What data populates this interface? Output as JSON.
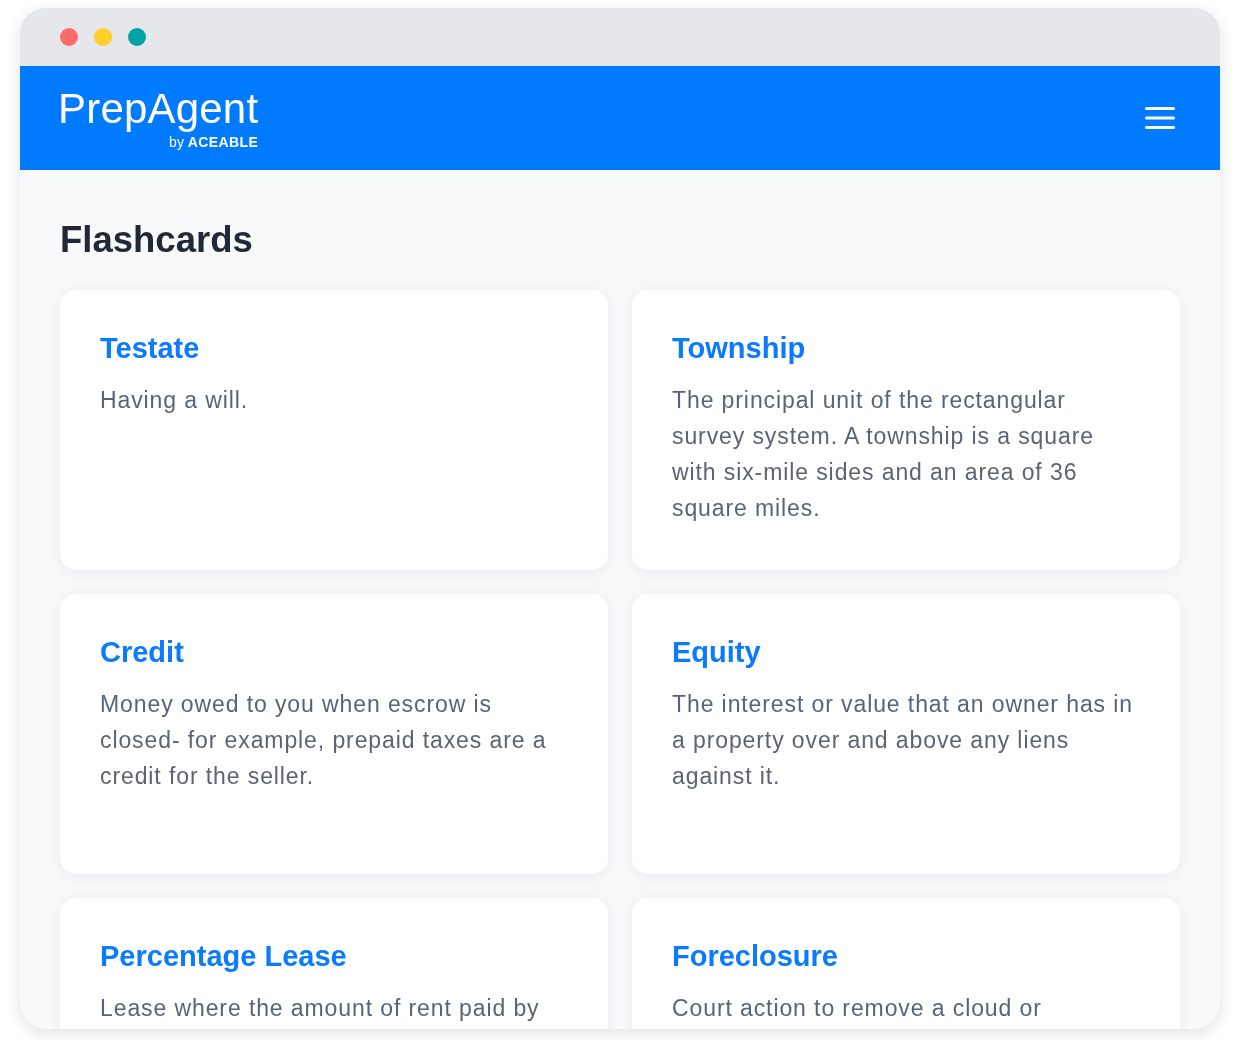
{
  "window": {
    "controls": [
      {
        "color": "#ff6b6b"
      },
      {
        "color": "#ffd02a"
      },
      {
        "color": "#00a3a3"
      }
    ]
  },
  "header": {
    "logo": "PrepAgent",
    "byline": "by **ACEABLE**"
  },
  "page": {
    "title": "Flashcards"
  },
  "flashcards": [
    {
      "term": "Testate",
      "definition": "Having a will."
    },
    {
      "term": "Township",
      "definition": "The principal unit of the rectangular survey system. A township is a square with six-mile sides and an area of 36 square miles."
    },
    {
      "term": "Credit",
      "definition": "Money owed to you when escrow is closed- for example, prepaid taxes are a credit for the seller."
    },
    {
      "term": "Equity",
      "definition": "The interest or value that an owner has in a property over and above any liens against it."
    },
    {
      "term": "Percentage Lease",
      "definition": "Lease where the amount of rent paid by"
    },
    {
      "term": "Foreclosure",
      "definition": "Court action to remove a cloud or"
    }
  ]
}
